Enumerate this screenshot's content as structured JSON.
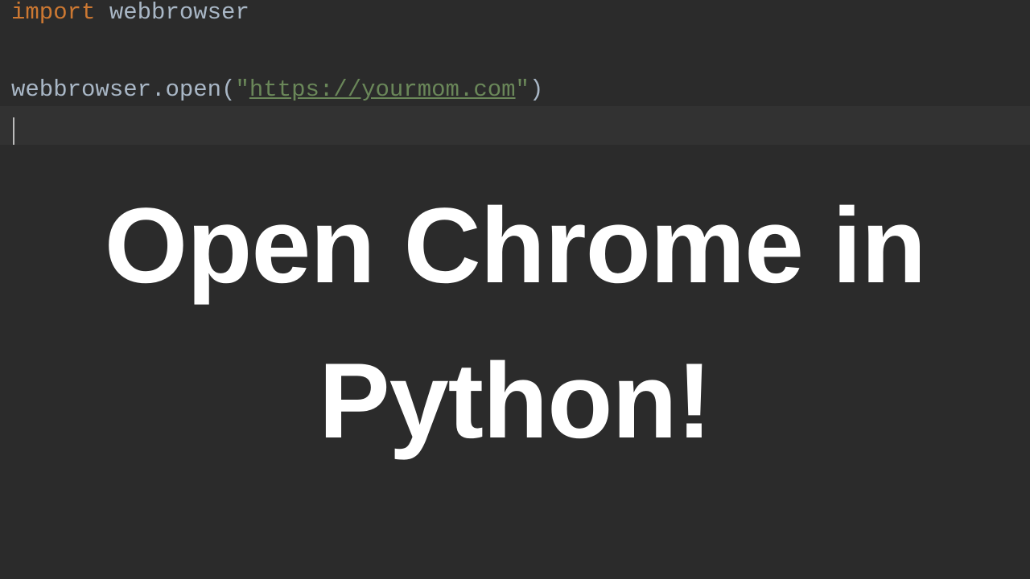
{
  "code": {
    "line1": {
      "keyword": "import",
      "module": "webbrowser"
    },
    "line3": {
      "object": "webbrowser",
      "dot": ".",
      "method": "open",
      "lparen": "(",
      "quote_open": "\"",
      "url": "https://yourmom.com",
      "quote_close": "\"",
      "rparen": ")"
    }
  },
  "overlay": {
    "title_line1": "Open Chrome in",
    "title_line2": "Python!"
  }
}
